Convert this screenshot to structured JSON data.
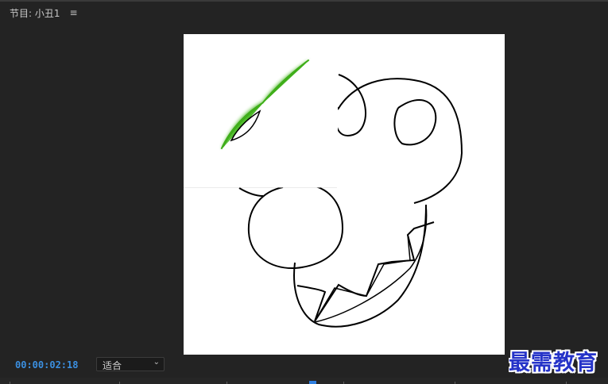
{
  "panel": {
    "title": "节目: 小丑1",
    "menu_icon": "hamburger-menu-icon"
  },
  "controls": {
    "timecode": "00:00:02:18",
    "fit_value": "适合",
    "fit_icon": "chevron-down-icon"
  },
  "watermark": {
    "text": "最需教育"
  },
  "colors": {
    "background": "#232323",
    "timecode": "#3b8fe0",
    "playhead": "#2f7fe0",
    "mask_highlight": "#43b81c",
    "watermark": "#2533c8"
  }
}
